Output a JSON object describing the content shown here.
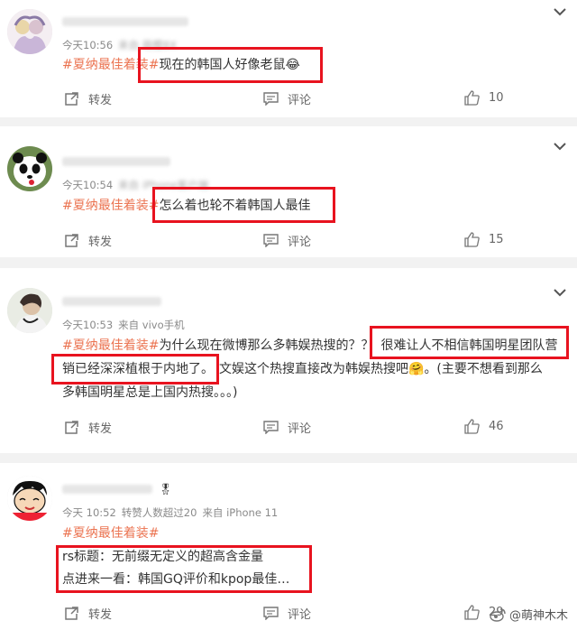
{
  "posts": [
    {
      "time": "今天10:56",
      "source": "来自 萌樱8X",
      "hashtag": "#夏纳最佳着装#",
      "highlight": "现在的韩国人好像老鼠",
      "emoji": "😂",
      "repost_label": "转发",
      "comment_label": "评论",
      "likes": "10"
    },
    {
      "time": "今天10:54",
      "source": "来自 iPhone客户端",
      "hashtag": "#夏纳最佳着装#",
      "highlight": "怎么着也轮不着韩国人最佳",
      "repost_label": "转发",
      "comment_label": "评论",
      "likes": "15"
    },
    {
      "time": "今天10:53",
      "source": "来自 vivo手机",
      "hashtag": "#夏纳最佳着装#",
      "text_a": "为什么现在微博那么多韩娱热搜的？？",
      "highlight_a": "很难让人不相信韩国明星团队营",
      "highlight_b": "销已经深深植根于内地了。",
      "text_b": "文娱这个热搜直接改为韩娱热搜吧",
      "emoji": "🤗",
      "text_c": "。(主要不想看到那么",
      "text_d": "多韩国明星总是上国内热搜。。。)",
      "repost_label": "转发",
      "comment_label": "评论",
      "likes": "46"
    },
    {
      "time": "今天 10:52",
      "extra": "转赞人数超过20",
      "source": "来自 iPhone 11",
      "hashtag": "#夏纳最佳着装#",
      "line1": "rs标题：无前缀无定义的超高含金量",
      "line2": "点进来一看：韩国GQ评价和kpop最佳…",
      "repost_label": "转发",
      "comment_label": "评论",
      "likes": "29"
    }
  ],
  "watermark": "@萌神木木",
  "colors": {
    "hashtag": "#eb7350",
    "highlight_box": "#e8131f",
    "meta": "#8a8a8a",
    "background": "#f2f2f2"
  },
  "icons": [
    "chevron-down-icon",
    "repost-icon",
    "comment-icon",
    "thumbs-up-icon",
    "weibo-logo-icon"
  ]
}
